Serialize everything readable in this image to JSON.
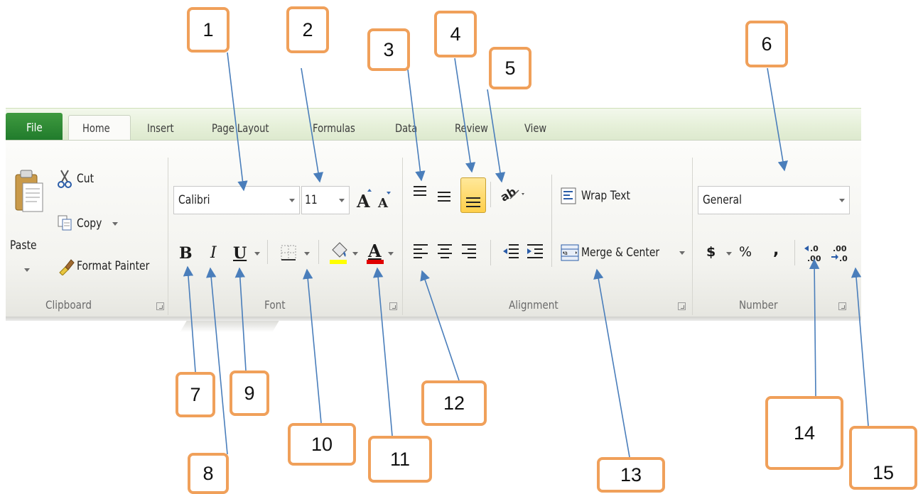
{
  "tabs": {
    "file": "File",
    "home": "Home",
    "insert": "Insert",
    "page_layout": "Page Layout",
    "formulas": "Formulas",
    "data": "Data",
    "review": "Review",
    "view": "View"
  },
  "clipboard": {
    "paste": "Paste",
    "cut": "Cut",
    "copy": "Copy",
    "format_painter": "Format Painter",
    "group_label": "Clipboard"
  },
  "font": {
    "font_name": "Calibri",
    "font_size": "11",
    "bold": "B",
    "italic": "I",
    "underline": "U",
    "group_label": "Font",
    "highlight_color": "#ffff00",
    "font_color": "#e00000"
  },
  "alignment": {
    "wrap_text": "Wrap Text",
    "merge_center": "Merge & Center",
    "group_label": "Alignment"
  },
  "number": {
    "format": "General",
    "currency": "$",
    "percent": "%",
    "comma": ",",
    "group_label": "Number"
  },
  "callouts": [
    "1",
    "2",
    "3",
    "4",
    "5",
    "6",
    "7",
    "8",
    "9",
    "10",
    "11",
    "12",
    "13",
    "14",
    "15"
  ],
  "colors": {
    "callout_border": "#f0a05a",
    "arrow": "#4a7ebb",
    "file_tab": "#2b8a35",
    "selected_button": "#ffd86a"
  }
}
